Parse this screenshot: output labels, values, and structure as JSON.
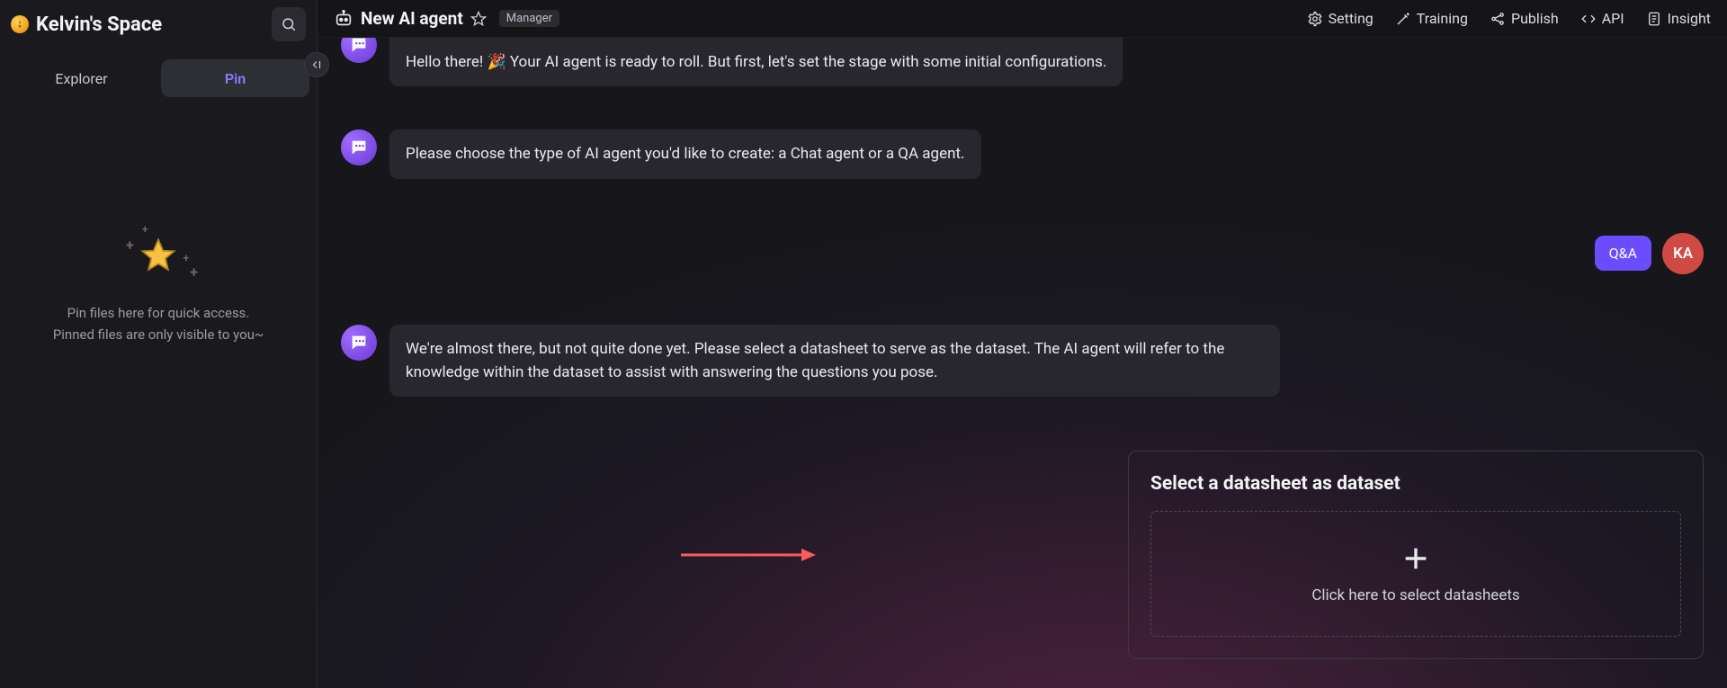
{
  "sidebar": {
    "workspace_name": "Kelvin's Space",
    "tabs": {
      "explorer": "Explorer",
      "pin": "Pin",
      "active": "pin"
    },
    "empty_line1": "Pin files here for quick access.",
    "empty_line2": "Pinned files are only visible to you~"
  },
  "topbar": {
    "title": "New AI agent",
    "badge": "Manager",
    "actions": {
      "setting": "Setting",
      "training": "Training",
      "publish": "Publish",
      "api": "API",
      "insight": "Insight"
    }
  },
  "conversation": {
    "bot1": "Hello there!  🎉  Your AI agent is ready to roll. But first, let's set the stage with some initial configurations.",
    "bot2": "Please choose the type of AI agent you'd like to create: a Chat agent or a QA agent.",
    "user1": "Q&A",
    "user_initials": "KA",
    "bot3": "We're almost there, but not quite done yet. Please select a datasheet to serve as the dataset. The AI agent will refer to the knowledge within the dataset to assist with answering the questions you pose."
  },
  "panel": {
    "title": "Select a datasheet as dataset",
    "dropzone": "Click here to select datasheets"
  }
}
